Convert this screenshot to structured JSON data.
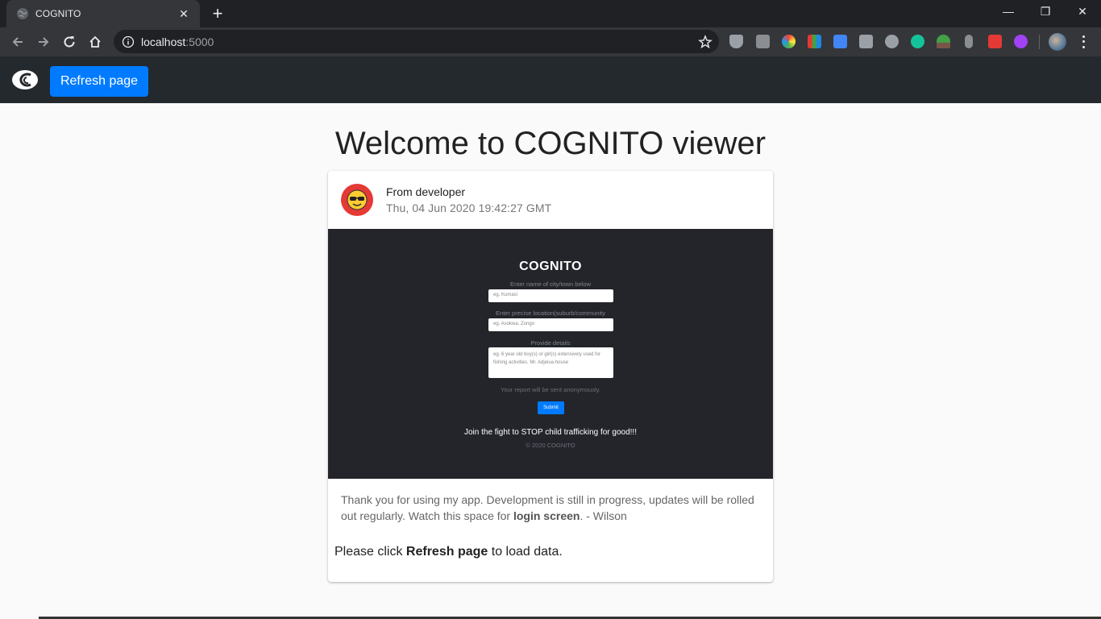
{
  "browser": {
    "tab_title": "COGNITO",
    "new_tab": "+",
    "close_tab": "✕",
    "url_host": "localhost",
    "url_port": ":5000",
    "window": {
      "minimize": "—",
      "restore": "❐",
      "close": "✕"
    },
    "extension_icons": [
      "shield-icon",
      "a-icon",
      "color-icon",
      "palette-icon",
      "translate-icon",
      "camera-icon",
      "cloud-icon",
      "grammarly-icon",
      "tree-icon",
      "figure-icon",
      "ruby-icon",
      "purple-icon"
    ]
  },
  "appbar": {
    "refresh_label": "Refresh page"
  },
  "main": {
    "title": "Welcome to COGNITO viewer"
  },
  "card": {
    "author": "From developer",
    "date": "Thu, 04 Jun 2020 19:42:27 GMT",
    "message_pre": "Thank you for using my app. Development is still in progress, updates will be rolled out regularly. Watch this space for ",
    "message_bold": "login screen",
    "message_post": ". - Wilson",
    "cta_pre": "Please click ",
    "cta_bold": "Refresh page",
    "cta_post": " to load data."
  },
  "screenshot": {
    "title": "COGNITO",
    "city_label": "Enter name of city/town below",
    "city_placeholder": "eg. Kumasi",
    "location_label": "Enter precise location(suburb/community",
    "location_placeholder": "eg. Asokwa, Zongo",
    "details_label": "Provide details",
    "details_placeholder": "eg. 6 year old boy(s) or girl(s) extensively used for fishing activities. Mr. Adjeiua house",
    "anon_note": "Your report will be sent anonymously.",
    "submit": "Submit",
    "slogan": "Join the fight to STOP child trafficking for good!!!",
    "copyright": "© 2020 COGNITO"
  }
}
